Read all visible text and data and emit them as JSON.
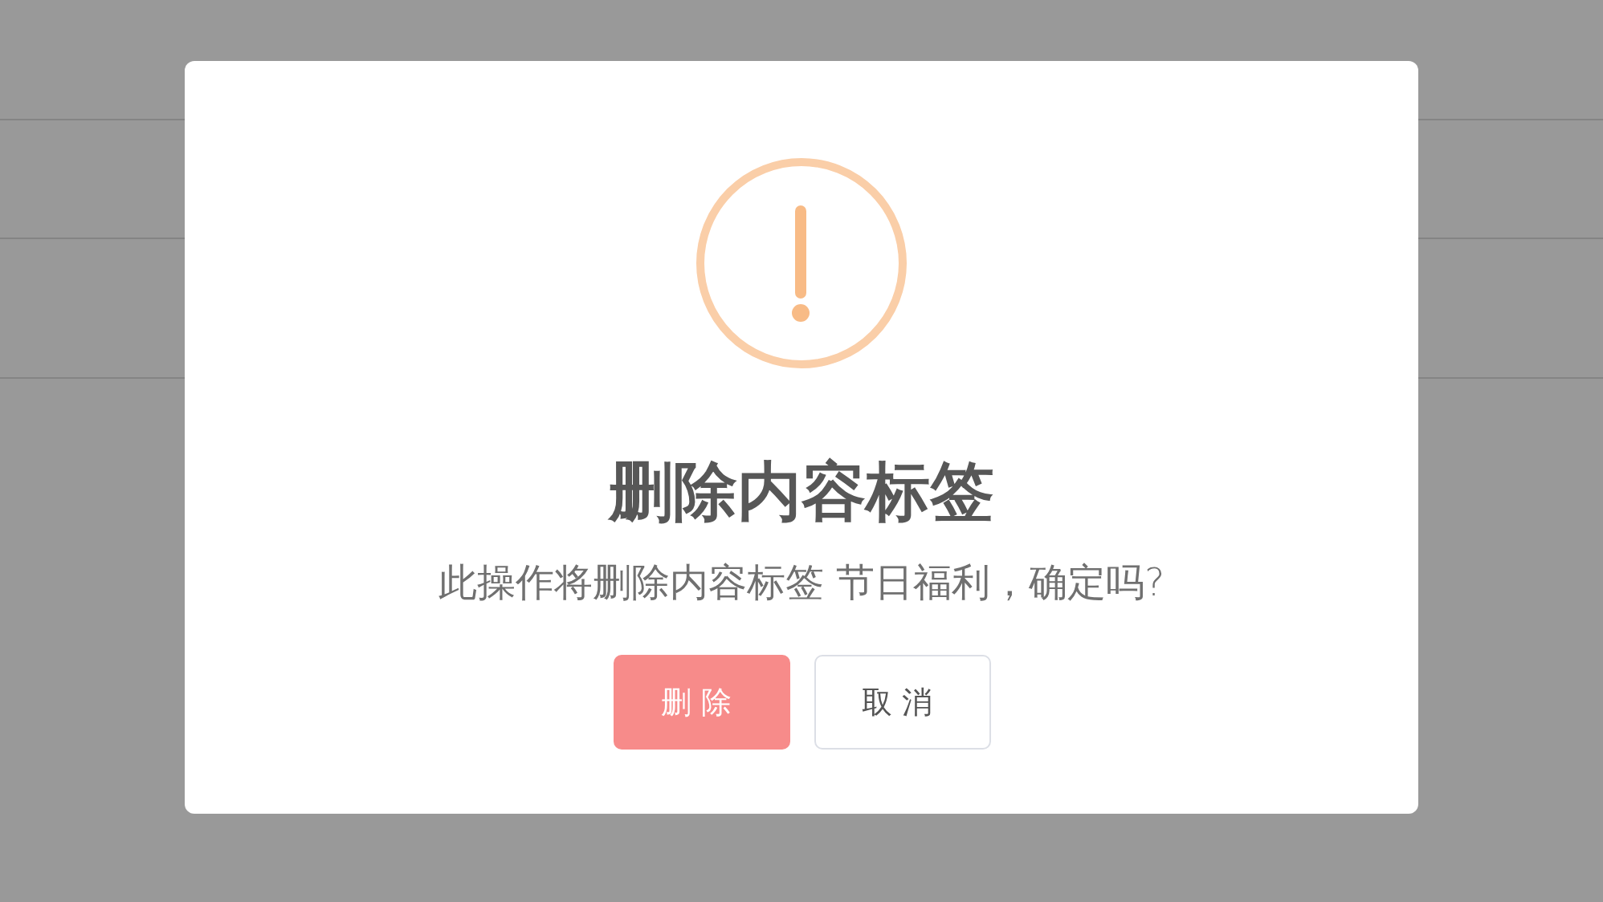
{
  "dialog": {
    "title": "删除内容标签",
    "message": "此操作将删除内容标签 节日福利，确定吗?",
    "buttons": [
      {
        "label": "删除",
        "kind": "danger"
      },
      {
        "label": "取消",
        "kind": "cancel"
      }
    ]
  }
}
